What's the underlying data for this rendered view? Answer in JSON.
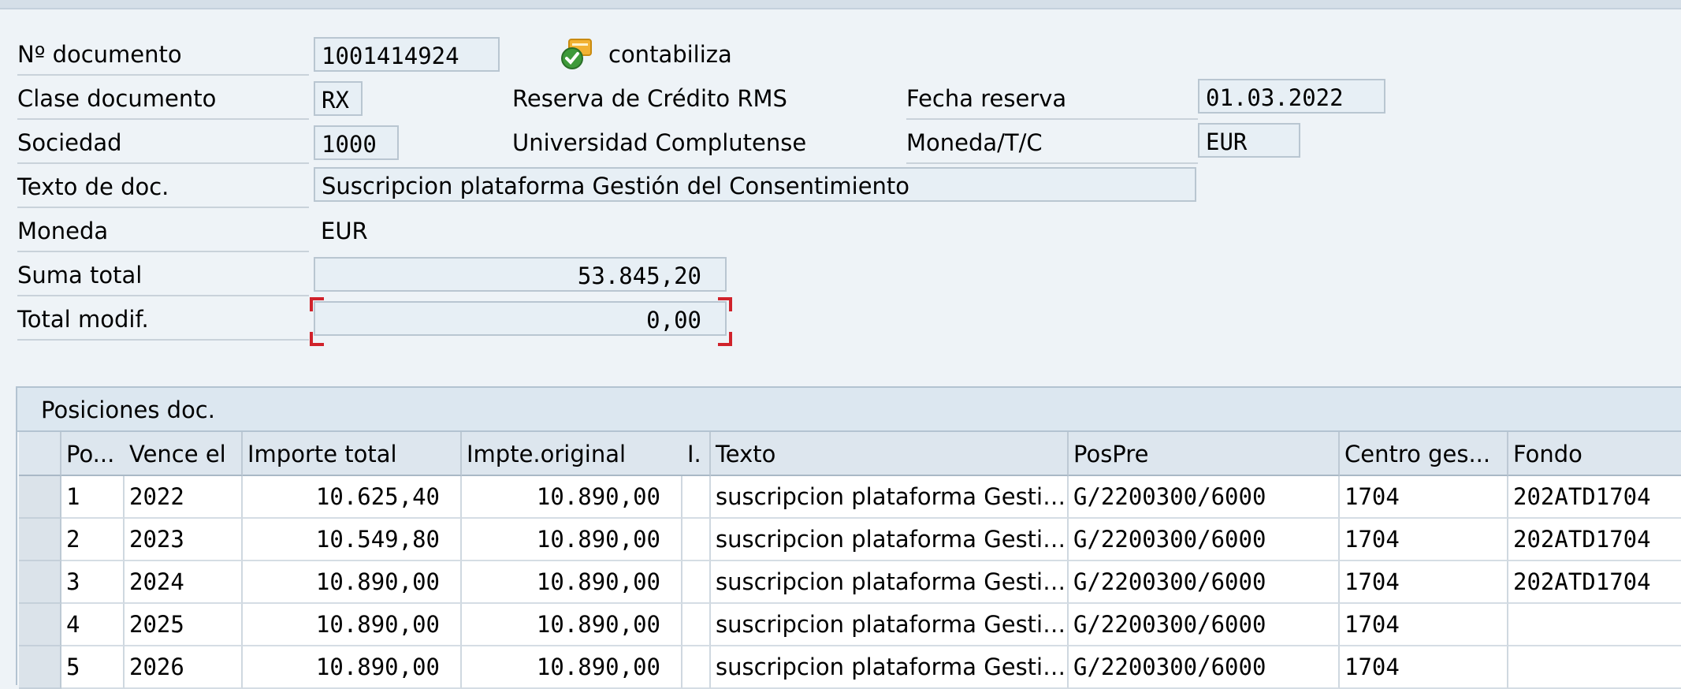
{
  "header": {
    "doc_number_label": "Nº documento",
    "doc_number_value": "1001414924",
    "post_action_label": "contabiliza",
    "post_action_icon": "post-document-icon",
    "doc_class_label": "Clase documento",
    "doc_class_value": "RX",
    "doc_class_description": "Reserva de Crédito RMS",
    "reservation_date_label": "Fecha reserva",
    "reservation_date_value": "01.03.2022",
    "company_label": "Sociedad",
    "company_value": "1000",
    "company_description": "Universidad Complutense",
    "currency_rate_label": "Moneda/T/C",
    "currency_rate_value": "EUR",
    "doc_text_label": "Texto de doc.",
    "doc_text_value": "Suscripcion plataforma Gestión del Consentimiento",
    "currency_label": "Moneda",
    "currency_value": "EUR",
    "total_label": "Suma total",
    "total_value": "53.845,20",
    "total_modified_label": "Total modif.",
    "total_modified_value": "0,00"
  },
  "positions": {
    "title": "Posiciones doc.",
    "columns": [
      "Po...",
      "Vence el",
      "Importe total",
      "Impte.original",
      "I.",
      "Texto",
      "PosPre",
      "Centro ges...",
      "Fondo"
    ],
    "rows": [
      {
        "pos": "1",
        "due": "2022",
        "total": "10.625,40",
        "original": "10.890,00",
        "ind": "",
        "text": "suscripcion plataforma Gesti…",
        "budget_pos": "G/2200300/6000",
        "center": "1704",
        "fund": "202ATD1704"
      },
      {
        "pos": "2",
        "due": "2023",
        "total": "10.549,80",
        "original": "10.890,00",
        "ind": "",
        "text": "suscripcion plataforma Gesti…",
        "budget_pos": "G/2200300/6000",
        "center": "1704",
        "fund": "202ATD1704"
      },
      {
        "pos": "3",
        "due": "2024",
        "total": "10.890,00",
        "original": "10.890,00",
        "ind": "",
        "text": "suscripcion plataforma Gesti…",
        "budget_pos": "G/2200300/6000",
        "center": "1704",
        "fund": "202ATD1704"
      },
      {
        "pos": "4",
        "due": "2025",
        "total": "10.890,00",
        "original": "10.890,00",
        "ind": "",
        "text": "suscripcion plataforma Gesti…",
        "budget_pos": "G/2200300/6000",
        "center": "1704",
        "fund": ""
      },
      {
        "pos": "5",
        "due": "2026",
        "total": "10.890,00",
        "original": "10.890,00",
        "ind": "",
        "text": "suscripcion plataforma Gesti…",
        "budget_pos": "G/2200300/6000",
        "center": "1704",
        "fund": ""
      }
    ]
  }
}
